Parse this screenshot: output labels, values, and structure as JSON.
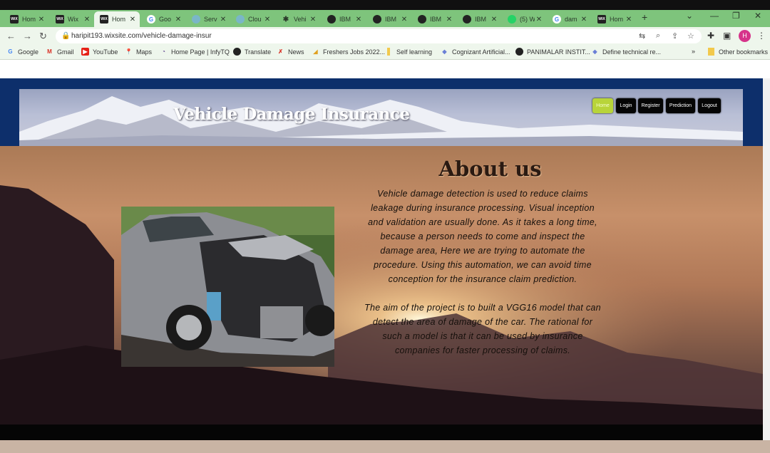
{
  "browser": {
    "tabs": [
      {
        "label": "Hom",
        "icon": "wix-icon"
      },
      {
        "label": "Wix",
        "icon": "wix-icon"
      },
      {
        "label": "Hom",
        "icon": "wix-icon",
        "active": true
      },
      {
        "label": "Goo",
        "icon": "google-icon"
      },
      {
        "label": "Serv",
        "icon": "cloud-icon"
      },
      {
        "label": "Clou",
        "icon": "cloud-icon"
      },
      {
        "label": "Vehi",
        "icon": "bug-icon"
      },
      {
        "label": "IBM",
        "icon": "globe-icon"
      },
      {
        "label": "IBM",
        "icon": "globe-icon"
      },
      {
        "label": "IBM",
        "icon": "github-icon"
      },
      {
        "label": "IBM",
        "icon": "github-icon"
      },
      {
        "label": "(5) W",
        "icon": "whatsapp-icon"
      },
      {
        "label": "dam",
        "icon": "google-icon"
      },
      {
        "label": "Hom",
        "icon": "wix-icon"
      }
    ],
    "url": "haripit193.wixsite.com/vehicle-damage-insur",
    "avatar_letter": "H",
    "bookmarks": [
      {
        "label": "Google",
        "icon": "google-icon"
      },
      {
        "label": "Gmail",
        "icon": "gmail-icon"
      },
      {
        "label": "YouTube",
        "icon": "youtube-icon"
      },
      {
        "label": "Maps",
        "icon": "maps-icon"
      },
      {
        "label": "Home Page | InfyTQ",
        "icon": "infytq-icon"
      },
      {
        "label": "Translate",
        "icon": "globe-icon"
      },
      {
        "label": "News",
        "icon": "news-icon"
      },
      {
        "label": "Freshers Jobs 2022...",
        "icon": "freshers-icon"
      },
      {
        "label": "Self learning",
        "icon": "folder-icon"
      },
      {
        "label": "Cognizant Artificial...",
        "icon": "diamond-icon"
      },
      {
        "label": "PANIMALAR INSTIT...",
        "icon": "globe-icon"
      },
      {
        "label": "Define technical re...",
        "icon": "diamond-icon"
      }
    ],
    "bookmarks_more": "»",
    "other_bookmarks": "Other bookmarks"
  },
  "site": {
    "title": "Vehicle Damage Insurance",
    "menu": [
      {
        "label": "Home",
        "active": true
      },
      {
        "label": "Login"
      },
      {
        "label": "Register"
      },
      {
        "label": "Prediction"
      },
      {
        "label": "Logout"
      }
    ],
    "about": {
      "heading": "About us",
      "para1": [
        "Vehicle damage detection is used to reduce claims",
        "leakage during insurance processing. Visual inception",
        "and validation are usually done. As it takes a long time,",
        "because a person needs to come and inspect the",
        "damage area, Here we are trying to automate the",
        "procedure. Using this automation, we can avoid time",
        "conception for the insurance claim prediction."
      ],
      "para2": [
        "The aim of the project is to built a VGG16 model that can",
        "detect the area of damage of the car. The rational for",
        "such a model is that it can be used by insurance",
        "companies for faster processing of claims."
      ]
    }
  },
  "colors": {
    "tab_bar": "#7ec47c",
    "header_band": "#0d2f6b",
    "home_button": "#b8d43a"
  }
}
